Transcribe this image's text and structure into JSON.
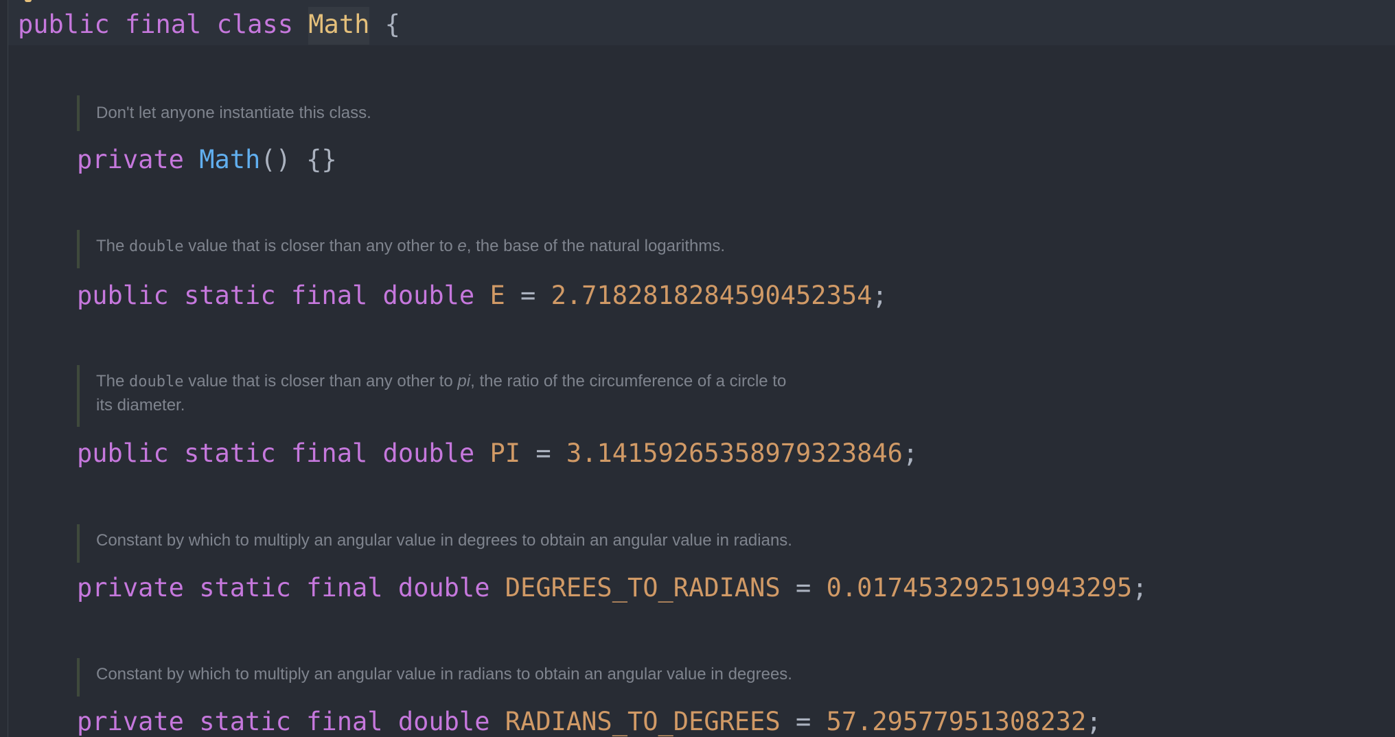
{
  "editor": {
    "theme": {
      "background": "#282c34",
      "keyword": "#c678dd",
      "class_name": "#e5c07b",
      "method": "#61afef",
      "constant": "#d19a66",
      "punctuation": "#abb2bf",
      "doc_text": "#7f848e"
    },
    "class_decl": {
      "kw_public": "public",
      "kw_final": "final",
      "kw_class": "class",
      "name": "Math",
      "brace": "{"
    },
    "ctor": {
      "doc": "Don't let anyone instantiate this class.",
      "kw_private": "private",
      "name": "Math",
      "rest": "() {}"
    },
    "e_field": {
      "doc_pre": "The",
      "doc_code": "double",
      "doc_mid": "value that is closer than any other to",
      "doc_em": "e",
      "doc_post": ", the base of the natural logarithms.",
      "kw_public": "public",
      "kw_static": "static",
      "kw_final": "final",
      "kw_double": "double",
      "name": "E",
      "eq": "=",
      "value": "2.7182818284590452354",
      "semi": ";"
    },
    "pi_field": {
      "doc_pre": "The",
      "doc_code": "double",
      "doc_mid": "value that is closer than any other to",
      "doc_em": "pi",
      "doc_post": ", the ratio of the circumference of a circle to",
      "doc_line2": "its diameter.",
      "kw_public": "public",
      "kw_static": "static",
      "kw_final": "final",
      "kw_double": "double",
      "name": "PI",
      "eq": "=",
      "value": "3.14159265358979323846",
      "semi": ";"
    },
    "deg_field": {
      "doc": "Constant by which to multiply an angular value in degrees to obtain an angular value in radians.",
      "kw_private": "private",
      "kw_static": "static",
      "kw_final": "final",
      "kw_double": "double",
      "name": "DEGREES_TO_RADIANS",
      "eq": "=",
      "value": "0.017453292519943295",
      "semi": ";"
    },
    "rad_field": {
      "doc": "Constant by which to multiply an angular value in radians to obtain an angular value in degrees.",
      "kw_private": "private",
      "kw_static": "static",
      "kw_final": "final",
      "kw_double": "double",
      "name": "RADIANS_TO_DEGREES",
      "eq": "=",
      "value": "57.29577951308232",
      "semi": ";"
    }
  }
}
